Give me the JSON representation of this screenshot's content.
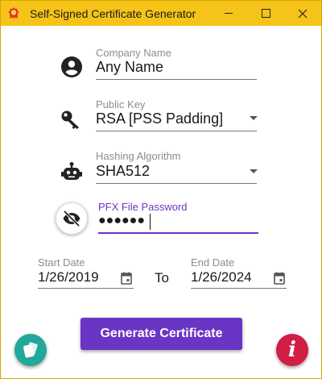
{
  "window": {
    "title": "Self-Signed Certificate Generator",
    "icon": "certificate-badge-icon",
    "accent_color": "#f6c418"
  },
  "form": {
    "company": {
      "label": "Company Name",
      "value": "Any Name",
      "icon": "account-circle-icon"
    },
    "public_key": {
      "label": "Public Key",
      "value": "RSA [PSS Padding]",
      "icon": "key-icon"
    },
    "hashing": {
      "label": "Hashing Algorithm",
      "value": "SHA512",
      "icon": "robot-icon"
    },
    "pfx": {
      "label": "PFX File Password",
      "value": "●●●●●●",
      "icon": "eye-off-icon"
    },
    "start_date": {
      "label": "Start Date",
      "value": "1/26/2019"
    },
    "to_label": "To",
    "end_date": {
      "label": "End Date",
      "value": "1/26/2024"
    }
  },
  "actions": {
    "generate_label": "Generate Certificate",
    "left_fab_icon": "cards-icon",
    "info_label": "i",
    "primary_color": "#6a35c4"
  }
}
